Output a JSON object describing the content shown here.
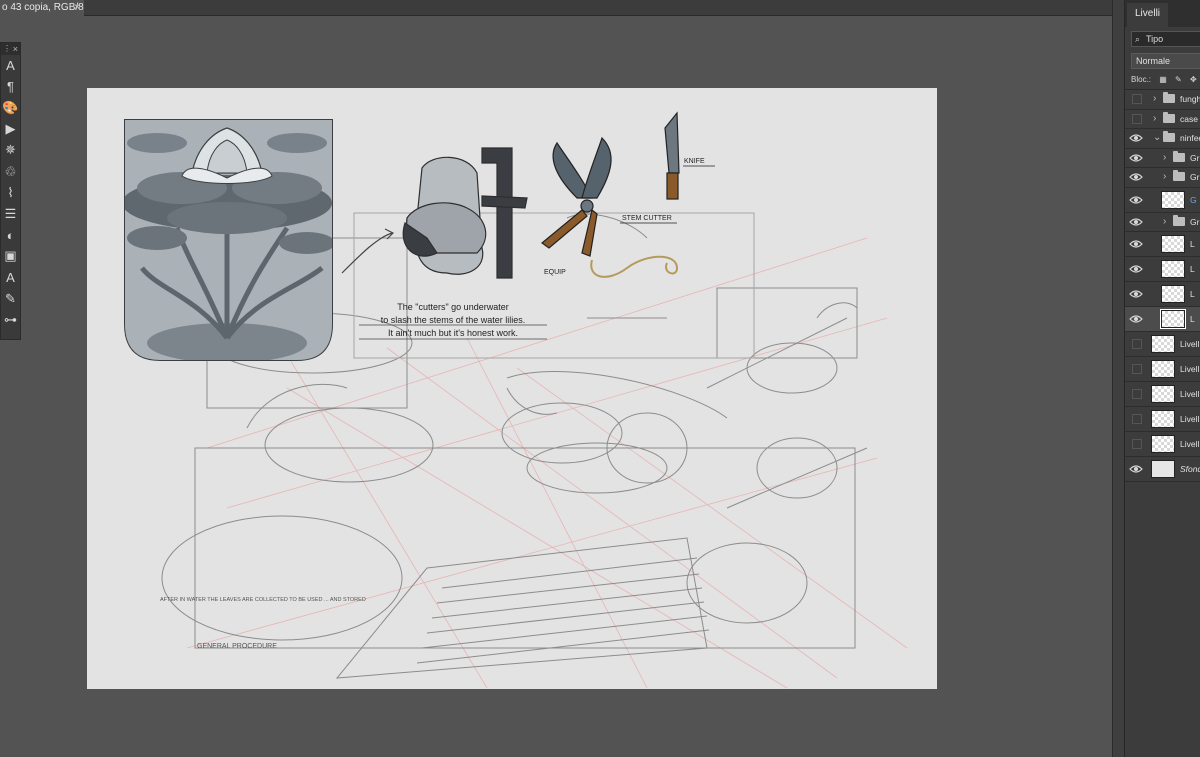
{
  "document": {
    "tab_title": "o 43 copia, RGB/8) *",
    "close_symbol": "×"
  },
  "tools_panel": {
    "close_symbol": "×",
    "tools": [
      {
        "name": "type-icon",
        "glyph": "A"
      },
      {
        "name": "paragraph-icon",
        "glyph": "¶"
      },
      {
        "name": "color-palette-icon",
        "glyph": "🎨"
      },
      {
        "name": "play-icon",
        "glyph": "▶"
      },
      {
        "name": "puppet-warp-icon",
        "glyph": "✵"
      },
      {
        "name": "history-brush-icon",
        "glyph": "♲"
      },
      {
        "name": "path-icon",
        "glyph": "⌇"
      },
      {
        "name": "adjustments-icon",
        "glyph": "☰"
      },
      {
        "name": "contrast-icon",
        "glyph": "◐"
      },
      {
        "name": "swatches-icon",
        "glyph": "▣"
      },
      {
        "name": "character-icon",
        "glyph": "A"
      },
      {
        "name": "brush-icon",
        "glyph": "✎"
      },
      {
        "name": "slider-settings-icon",
        "glyph": "⊶"
      }
    ]
  },
  "canvas": {
    "artboard_color": "#e3e3e3",
    "caption_lines": [
      "The \"cutters\" go underwater",
      "to slash the stems of the water lilies.",
      "It ain't much but it's honest work."
    ],
    "labels": {
      "knife": "KNIFE",
      "stem_cutter": "STEM CUTTER",
      "equip": "EQUIP",
      "notes_left": "AFTER IN WATER THE LEAVES ARE COLLECTED TO BE USED ... AND STORED",
      "general_procedure": "GENERAL   PROCEDURE"
    }
  },
  "layers_panel": {
    "tab_label": "Livelli",
    "search_placeholder": "Tipo",
    "search_icon": "magnifier-icon",
    "blend_mode": "Normale",
    "lock_label": "Bloc.:",
    "layers": [
      {
        "name": "funghi",
        "type": "group",
        "visible": false,
        "indent": 0,
        "expanded": false
      },
      {
        "name": "case",
        "type": "group",
        "visible": false,
        "indent": 0,
        "expanded": false
      },
      {
        "name": "ninfee",
        "type": "group",
        "visible": true,
        "indent": 0,
        "expanded": true
      },
      {
        "name": "Gr",
        "type": "group",
        "visible": true,
        "indent": 1,
        "expanded": false
      },
      {
        "name": "Gr",
        "type": "group",
        "visible": true,
        "indent": 1,
        "expanded": false
      },
      {
        "name": "G",
        "type": "layer",
        "visible": true,
        "indent": 1,
        "blue": true
      },
      {
        "name": "Gr",
        "type": "group",
        "visible": true,
        "indent": 1,
        "expanded": false
      },
      {
        "name": "L",
        "type": "layer",
        "visible": true,
        "indent": 1
      },
      {
        "name": "L",
        "type": "layer",
        "visible": true,
        "indent": 1
      },
      {
        "name": "L",
        "type": "layer",
        "visible": true,
        "indent": 1
      },
      {
        "name": "L",
        "type": "layer",
        "visible": true,
        "indent": 1,
        "selected": true
      },
      {
        "name": "Livell",
        "type": "layer",
        "visible": false,
        "indent": 0
      },
      {
        "name": "Livell",
        "type": "layer",
        "visible": false,
        "indent": 0
      },
      {
        "name": "Livell",
        "type": "layer",
        "visible": false,
        "indent": 0
      },
      {
        "name": "Livell",
        "type": "layer",
        "visible": false,
        "indent": 0
      },
      {
        "name": "Livell",
        "type": "layer",
        "visible": false,
        "indent": 0
      },
      {
        "name": "Sfond",
        "type": "background",
        "visible": true,
        "indent": 0,
        "italic": true
      }
    ]
  }
}
